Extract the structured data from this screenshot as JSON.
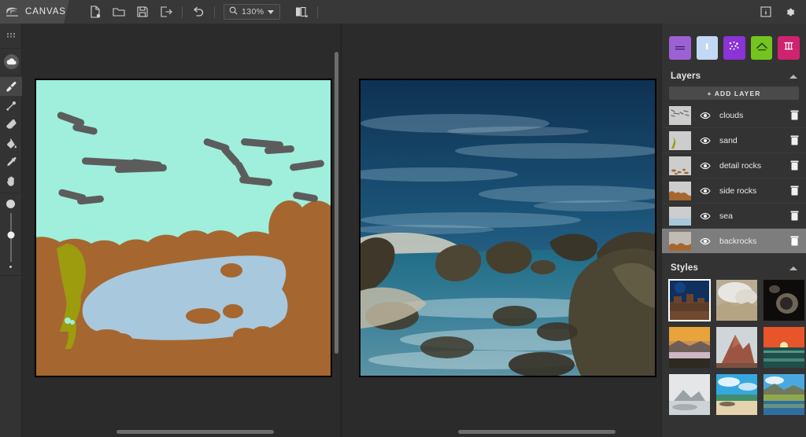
{
  "app": {
    "brand": "CANVAS",
    "logo_icon": "nvidia-logo-icon"
  },
  "toolbar": {
    "buttons": [
      {
        "name": "new-file-button",
        "icon": "new-file-icon",
        "label": "New"
      },
      {
        "name": "open-file-button",
        "icon": "folder-open-icon",
        "label": "Open"
      },
      {
        "name": "save-file-button",
        "icon": "save-disk-icon",
        "label": "Save"
      },
      {
        "name": "export-button",
        "icon": "export-arrow-icon",
        "label": "Export"
      }
    ],
    "undo": {
      "name": "undo-button",
      "icon": "undo-arrow-icon",
      "label": "Undo"
    },
    "zoom": {
      "icon": "magnifier-icon",
      "value": "130%",
      "caret_icon": "chevron-down-icon"
    },
    "compare_view": {
      "name": "split-view-button",
      "icon": "split-panel-icon",
      "label": "Compare"
    },
    "info": {
      "name": "info-button",
      "icon": "info-icon",
      "label": "Info"
    },
    "settings": {
      "name": "settings-button",
      "icon": "gear-icon",
      "label": "Settings"
    }
  },
  "tools": {
    "material_picker": {
      "icon": "cloud-material-icon",
      "label": "Material"
    },
    "items": [
      {
        "name": "brush-tool",
        "icon": "paintbrush-icon",
        "label": "Paintbrush",
        "active": true
      },
      {
        "name": "pen-tool",
        "icon": "pen-line-icon",
        "label": "Pen",
        "active": false
      },
      {
        "name": "eraser-tool",
        "icon": "eraser-icon",
        "label": "Eraser",
        "active": false
      },
      {
        "name": "fill-tool",
        "icon": "paint-bucket-icon",
        "label": "Paint Bucket",
        "active": false
      },
      {
        "name": "eyedropper-tool",
        "icon": "eyedropper-icon",
        "label": "Eyedropper",
        "active": false
      },
      {
        "name": "pan-tool",
        "icon": "hand-icon",
        "label": "Pan",
        "active": false
      }
    ],
    "brush_size": {
      "label": "Brush Size",
      "max_preview_icon": "large-dot-icon",
      "min_preview_icon": "small-dot-icon",
      "handle_position_pct": 45
    }
  },
  "canvas": {
    "segmentation": {
      "label": "Segmentation sketch",
      "sky_color": "#9fefdc",
      "cloud_color": "#5c5c5c",
      "rock_color": "#a5672f",
      "water_color": "#a8c8de",
      "sand_color": "#9c9c0e"
    },
    "render": {
      "label": "AI rendered seascape",
      "sky_color": "#1b4a72",
      "water_color": "#2b6b86",
      "rock_color": "#4a4434"
    },
    "scrollbars": {
      "vertical": "canvas-vertical-scrollbar",
      "horizontal": "canvas-horizontal-scrollbar"
    }
  },
  "materials": [
    {
      "name": "material-water",
      "label": "Water",
      "color": "#9b62d4",
      "icon": "waves-icon"
    },
    {
      "name": "material-sky",
      "label": "Sky",
      "color": "#c3d8f5",
      "icon": "sky-icon"
    },
    {
      "name": "material-clouds",
      "label": "Clouds",
      "color": "#8a33d6",
      "icon": "sparkle-icon"
    },
    {
      "name": "material-mountain",
      "label": "Mountain",
      "color": "#73c41e",
      "icon": "mountain-icon"
    },
    {
      "name": "material-rock",
      "label": "Rock",
      "color": "#cf2370",
      "icon": "rock-icon"
    }
  ],
  "layers_panel": {
    "title": "Layers",
    "collapse_icon": "chevron-up-icon",
    "add_layer_label": "+ ADD LAYER",
    "eye_icon": "eye-visible-icon",
    "delete_icon": "trash-icon",
    "items": [
      {
        "name": "layer-clouds",
        "label": "clouds",
        "selected": false,
        "thumb": "clouds"
      },
      {
        "name": "layer-sand",
        "label": "sand",
        "selected": false,
        "thumb": "sand"
      },
      {
        "name": "layer-detail-rocks",
        "label": "detail rocks",
        "selected": false,
        "thumb": "detail"
      },
      {
        "name": "layer-side-rocks",
        "label": "side rocks",
        "selected": false,
        "thumb": "side"
      },
      {
        "name": "layer-sea",
        "label": "sea",
        "selected": false,
        "thumb": "sea"
      },
      {
        "name": "layer-backrocks",
        "label": "backrocks",
        "selected": true,
        "thumb": "back"
      }
    ]
  },
  "styles_panel": {
    "title": "Styles",
    "collapse_icon": "chevron-up-icon",
    "items": [
      {
        "name": "style-desert-night",
        "label": "Desert Night",
        "selected": true
      },
      {
        "name": "style-white-cliffs",
        "label": "White Cliffs",
        "selected": false
      },
      {
        "name": "style-dark-cave",
        "label": "Dark Cave",
        "selected": false
      },
      {
        "name": "style-golden-fog",
        "label": "Golden Fog",
        "selected": false
      },
      {
        "name": "style-red-peaks",
        "label": "Red Peaks",
        "selected": false
      },
      {
        "name": "style-ocean-sunset",
        "label": "Ocean Sunset",
        "selected": false
      },
      {
        "name": "style-misty-gray",
        "label": "Misty Gray",
        "selected": false
      },
      {
        "name": "style-tropical-beach",
        "label": "Tropical Beach",
        "selected": false
      },
      {
        "name": "style-green-valley",
        "label": "Green Valley",
        "selected": false
      }
    ]
  }
}
